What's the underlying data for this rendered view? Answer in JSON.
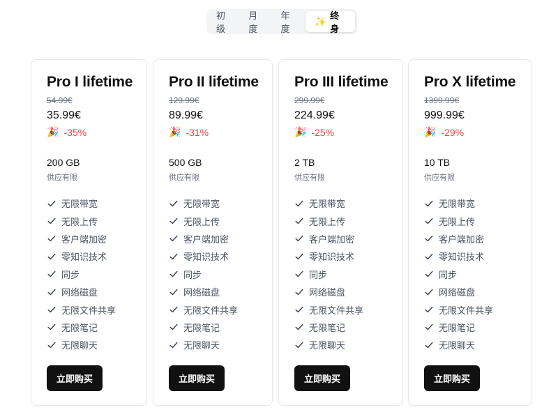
{
  "tabs": [
    {
      "label": "初级"
    },
    {
      "label": "月度"
    },
    {
      "label": "年度"
    },
    {
      "label": "终身",
      "icon": "sparkles-icon",
      "active": true
    }
  ],
  "plans": [
    {
      "title": "Pro I lifetime",
      "original_price": "54.99€",
      "price": "35.99€",
      "discount": "-35%",
      "storage": "200 GB",
      "supply": "供应有限",
      "features": [
        "无限带宽",
        "无限上传",
        "客户端加密",
        "零知识技术",
        "同步",
        "网络磁盘",
        "无限文件共享",
        "无限笔记",
        "无限聊天"
      ],
      "button": "立即购买"
    },
    {
      "title": "Pro II lifetime",
      "original_price": "129.99€",
      "price": "89.99€",
      "discount": "-31%",
      "storage": "500 GB",
      "supply": "供应有限",
      "features": [
        "无限带宽",
        "无限上传",
        "客户端加密",
        "零知识技术",
        "同步",
        "网络磁盘",
        "无限文件共享",
        "无限笔记",
        "无限聊天"
      ],
      "button": "立即购买"
    },
    {
      "title": "Pro III lifetime",
      "original_price": "299.99€",
      "price": "224.99€",
      "discount": "-25%",
      "storage": "2 TB",
      "supply": "供应有限",
      "features": [
        "无限带宽",
        "无限上传",
        "客户端加密",
        "零知识技术",
        "同步",
        "网络磁盘",
        "无限文件共享",
        "无限笔记",
        "无限聊天"
      ],
      "button": "立即购买"
    },
    {
      "title": "Pro X lifetime",
      "original_price": "1399.99€",
      "price": "999.99€",
      "discount": "-29%",
      "storage": "10 TB",
      "supply": "供应有限",
      "features": [
        "无限带宽",
        "无限上传",
        "客户端加密",
        "零知识技术",
        "同步",
        "网络磁盘",
        "无限文件共享",
        "无限笔记",
        "无限聊天"
      ],
      "button": "立即购买"
    }
  ],
  "colors": {
    "discount": "#ef4444",
    "button_bg": "#111111",
    "tab_bg": "#f3f4f6"
  }
}
